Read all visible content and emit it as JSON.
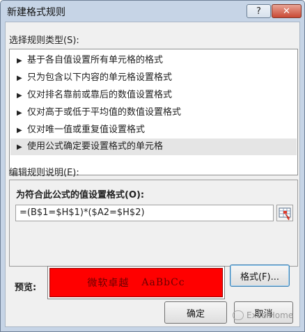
{
  "window": {
    "title": "新建格式规则",
    "help_icon": "?",
    "close_icon": "✕"
  },
  "rule_type": {
    "label": "选择规则类型(S):",
    "items": [
      {
        "label": "基于各自值设置所有单元格的格式",
        "selected": false
      },
      {
        "label": "只为包含以下内容的单元格设置格式",
        "selected": false
      },
      {
        "label": "仅对排名靠前或靠后的数值设置格式",
        "selected": false
      },
      {
        "label": "仅对高于或低于平均值的数值设置格式",
        "selected": false
      },
      {
        "label": "仅对唯一值或重复值设置格式",
        "selected": false
      },
      {
        "label": "使用公式确定要设置格式的单元格",
        "selected": true
      }
    ],
    "bullet_icon": "▶"
  },
  "edit": {
    "label": "编辑规则说明(E):",
    "formula_label": "为符合此公式的值设置格式(O):",
    "formula_value": "=(B$1=$H$1)*($A2=$H$2)",
    "ref_icon": "range-select-icon"
  },
  "preview": {
    "label": "预览:",
    "sample_cjk": "微软卓越",
    "sample_latin": "AaBbCc",
    "fill_color": "#ff0000"
  },
  "buttons": {
    "format": "格式(F)...",
    "ok": "确定",
    "cancel": "取消"
  },
  "watermark": {
    "text": "ExcelHome"
  }
}
